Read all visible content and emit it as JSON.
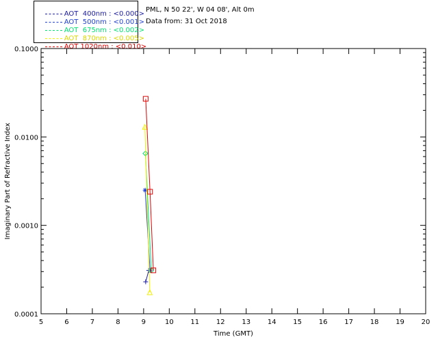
{
  "info": {
    "site": "PML, N 50 22', W 04 08', Alt 0m",
    "date": "Data from: 31 Oct 2018"
  },
  "chart_data": {
    "type": "line",
    "xlabel": "Time (GMT)",
    "ylabel": "Imaginary Part of Refractive Index",
    "xlim": [
      5,
      20
    ],
    "ylim": [
      0.0001,
      0.1
    ],
    "yscale": "log",
    "xticks": [
      "5",
      "6",
      "7",
      "8",
      "9",
      "10",
      "11",
      "12",
      "13",
      "14",
      "15",
      "16",
      "17",
      "18",
      "19",
      "20"
    ],
    "yticks": [
      {
        "value": 0.0001,
        "label": "0.0001"
      },
      {
        "value": 0.001,
        "label": "0.0010"
      },
      {
        "value": 0.01,
        "label": "0.0100"
      },
      {
        "value": 0.1,
        "label": "0.1000"
      }
    ],
    "legend_position": "top-left, outside",
    "series": [
      {
        "name": "AOT  400nm : <0.000>",
        "color": "#1a1a9e",
        "marker": "plus",
        "x": [
          9.08,
          9.2
        ],
        "y": [
          0.00023,
          0.00031
        ]
      },
      {
        "name": "AOT  500nm : <0.001>",
        "color": "#1f3fd0",
        "marker": "asterisk",
        "x": [
          9.06,
          9.25
        ],
        "y": [
          0.0025,
          0.00031
        ]
      },
      {
        "name": "AOT  675nm : <0.002>",
        "color": "#00e070",
        "marker": "diamond",
        "x": [
          9.07,
          9.3
        ],
        "y": [
          0.0065,
          0.00031
        ]
      },
      {
        "name": "AOT  870nm : <0.005>",
        "color": "#f0f000",
        "marker": "triangle",
        "x": [
          9.05,
          9.24
        ],
        "y": [
          0.013,
          0.000175
        ]
      },
      {
        "name": "AOT 1020nm : <0.010>",
        "color": "#e00000",
        "marker": "square",
        "x": [
          9.08,
          9.25,
          9.38
        ],
        "y": [
          0.027,
          0.0024,
          0.00031
        ]
      }
    ]
  }
}
